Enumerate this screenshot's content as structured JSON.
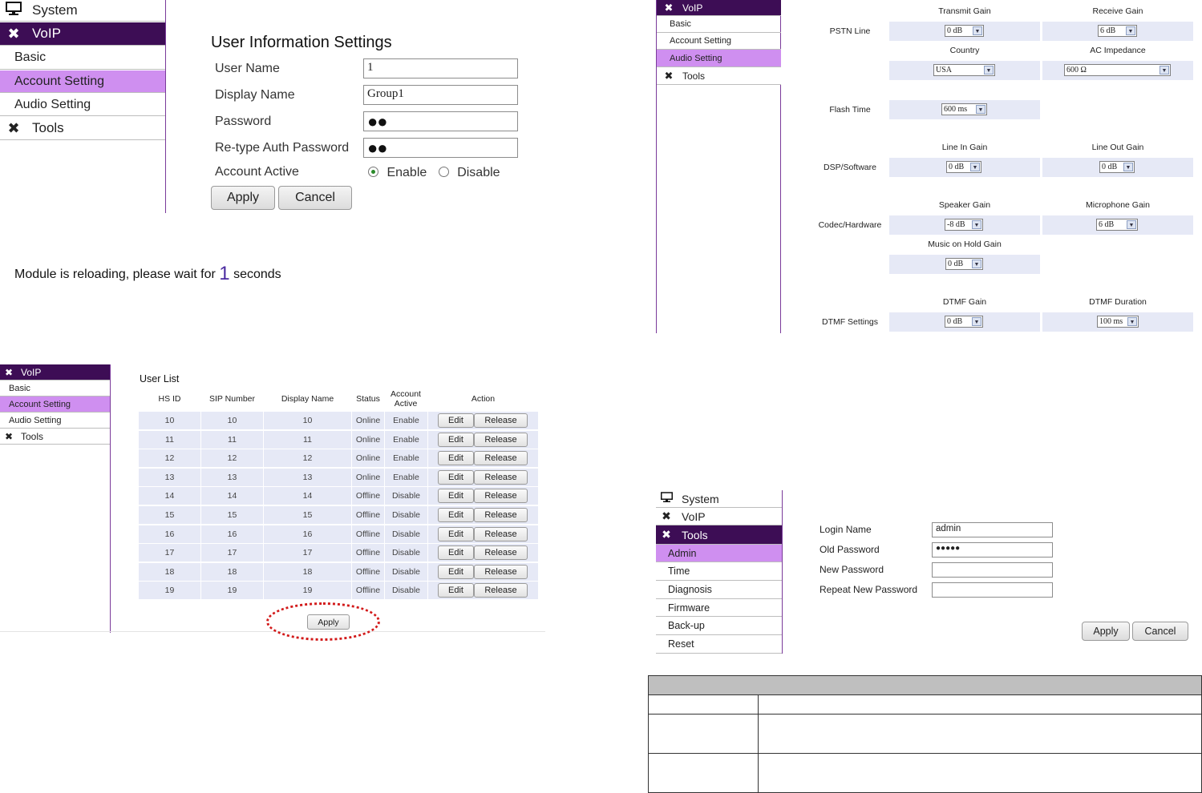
{
  "panel1": {
    "sidebar": {
      "system": "System",
      "voip": "VoIP",
      "basic": "Basic",
      "account_setting": "Account Setting",
      "audio_setting": "Audio Setting",
      "tools": "Tools"
    },
    "title": "User Information Settings",
    "fields": {
      "user_name_label": "User Name",
      "user_name_value": "1",
      "display_name_label": "Display Name",
      "display_name_value": "Group1",
      "password_label": "Password",
      "password_value": "●●",
      "retype_label": "Re-type Auth Password",
      "retype_value": "●●",
      "account_active_label": "Account Active",
      "enable": "Enable",
      "disable": "Disable"
    },
    "buttons": {
      "apply": "Apply",
      "cancel": "Cancel"
    },
    "reload": {
      "before": "Module is reloading, please wait for",
      "count": "1",
      "after": "seconds"
    }
  },
  "panel2": {
    "sidebar": {
      "voip": "VoIP",
      "basic": "Basic",
      "account_setting": "Account Setting",
      "audio_setting": "Audio Setting",
      "tools": "Tools"
    },
    "rows": {
      "pstn": "PSTN Line",
      "flash": "Flash Time",
      "dsp": "DSP/Software",
      "codec": "Codec/Hardware",
      "dtmf": "DTMF Settings"
    },
    "heads": {
      "transmit_gain": "Transmit Gain",
      "receive_gain": "Receive Gain",
      "country": "Country",
      "ac_impedance": "AC Impedance",
      "line_in_gain": "Line In Gain",
      "line_out_gain": "Line Out Gain",
      "speaker_gain": "Speaker Gain",
      "microphone_gain": "Microphone Gain",
      "music_on_hold_gain": "Music on Hold Gain",
      "dtmf_gain": "DTMF Gain",
      "dtmf_duration": "DTMF Duration"
    },
    "values": {
      "transmit_gain": "0 dB",
      "receive_gain": "6 dB",
      "country": "USA",
      "ac_impedance": "600 Ω",
      "flash_time": "600 ms",
      "line_in_gain": "0 dB",
      "line_out_gain": "0 dB",
      "speaker_gain": "-8 dB",
      "microphone_gain": "6 dB",
      "music_on_hold_gain": "0 dB",
      "dtmf_gain": "0 dB",
      "dtmf_duration": "100 ms"
    },
    "arrow": "▼"
  },
  "panel3": {
    "sidebar": {
      "voip": "VoIP",
      "basic": "Basic",
      "account_setting": "Account Setting",
      "audio_setting": "Audio Setting",
      "tools": "Tools"
    },
    "title": "User List",
    "headers": {
      "hs_id": "HS ID",
      "sip_number": "SIP Number",
      "display_name": "Display Name",
      "status": "Status",
      "account_active_1": "Account",
      "account_active_2": "Active",
      "action": "Action"
    },
    "rows": [
      {
        "hs_id": "10",
        "sip": "10",
        "name": "10",
        "status": "Online",
        "active": "Enable"
      },
      {
        "hs_id": "11",
        "sip": "11",
        "name": "11",
        "status": "Online",
        "active": "Enable"
      },
      {
        "hs_id": "12",
        "sip": "12",
        "name": "12",
        "status": "Online",
        "active": "Enable"
      },
      {
        "hs_id": "13",
        "sip": "13",
        "name": "13",
        "status": "Online",
        "active": "Enable"
      },
      {
        "hs_id": "14",
        "sip": "14",
        "name": "14",
        "status": "Offline",
        "active": "Disable"
      },
      {
        "hs_id": "15",
        "sip": "15",
        "name": "15",
        "status": "Offline",
        "active": "Disable"
      },
      {
        "hs_id": "16",
        "sip": "16",
        "name": "16",
        "status": "Offline",
        "active": "Disable"
      },
      {
        "hs_id": "17",
        "sip": "17",
        "name": "17",
        "status": "Offline",
        "active": "Disable"
      },
      {
        "hs_id": "18",
        "sip": "18",
        "name": "18",
        "status": "Offline",
        "active": "Disable"
      },
      {
        "hs_id": "19",
        "sip": "19",
        "name": "19",
        "status": "Offline",
        "active": "Disable"
      }
    ],
    "edit": "Edit",
    "release": "Release",
    "apply": "Apply"
  },
  "panel4": {
    "sidebar": {
      "system": "System",
      "voip": "VoIP",
      "tools": "Tools",
      "admin": "Admin",
      "time": "Time",
      "diagnosis": "Diagnosis",
      "firmware": "Firmware",
      "backup": "Back-up",
      "reset": "Reset"
    },
    "fields": {
      "login_name_label": "Login Name",
      "login_name_value": "admin",
      "old_password_label": "Old Password",
      "old_password_value": "●●●●●",
      "new_password_label": "New Password",
      "repeat_password_label": "Repeat New Password"
    },
    "buttons": {
      "apply": "Apply",
      "cancel": "Cancel"
    }
  },
  "colors": {
    "nav_dark": "#3d0d55",
    "nav_highlight": "#cf8ff0",
    "cell_bg": "#e6e9f6",
    "annotation_red": "#d21a1a",
    "table_header_gray": "#bfbfbf"
  }
}
